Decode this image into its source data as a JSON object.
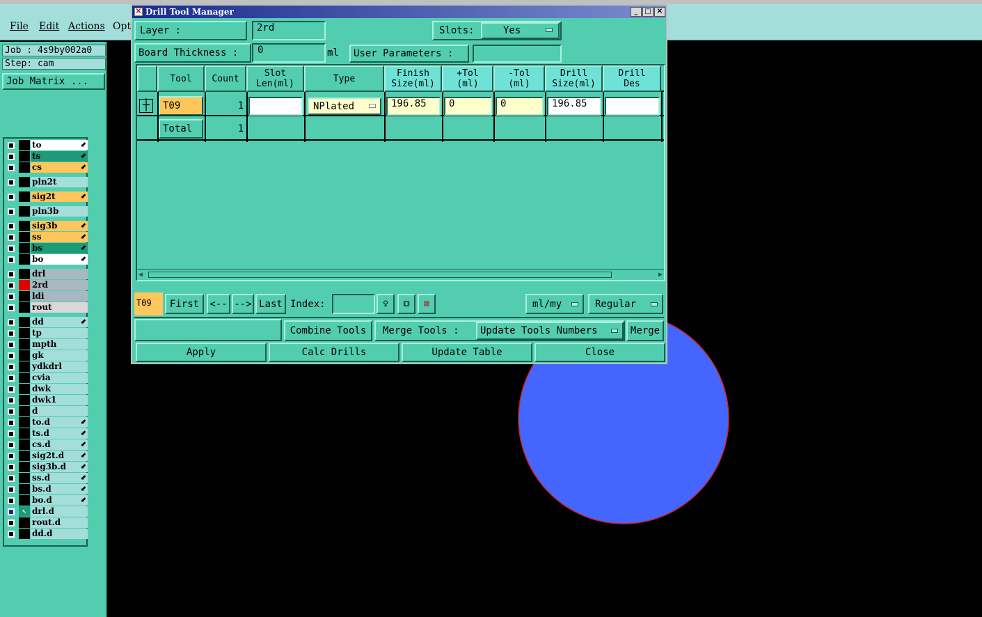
{
  "menubar": {
    "file": "File",
    "edit": "Edit",
    "actions": "Actions",
    "options": "Opti"
  },
  "left": {
    "job": "Job : 4s9by002a0",
    "step": "Step: cam",
    "job_matrix": "Job Matrix ...",
    "layers": [
      {
        "name": "to",
        "color": "#ffffff",
        "arrow": true
      },
      {
        "name": "ts",
        "color": "#1e9a78",
        "arrow": true
      },
      {
        "name": "cs",
        "color": "#ffc65c",
        "arrow": true
      },
      {
        "name": "pln2t",
        "color": "#a3dedb",
        "arrow": false
      },
      {
        "name": "sig2t",
        "color": "#ffc65c",
        "arrow": true
      },
      {
        "name": "pln3b",
        "color": "#a3dedb",
        "arrow": false
      },
      {
        "name": "sig3b",
        "color": "#ffc65c",
        "arrow": true
      },
      {
        "name": "ss",
        "color": "#ffc65c",
        "arrow": true
      },
      {
        "name": "bs",
        "color": "#1e9a78",
        "arrow": true
      },
      {
        "name": "bo",
        "color": "#ffffff",
        "arrow": true
      },
      {
        "name": "drl",
        "color": "#a8b8c0",
        "arrow": false
      },
      {
        "name": "2rd",
        "color": "#a8b8c0",
        "arrow": false
      },
      {
        "name": "ldi",
        "color": "#a8b8c0",
        "arrow": false
      },
      {
        "name": "rout",
        "color": "#d8d8d8",
        "arrow": false
      },
      {
        "name": "dd",
        "color": "#a3dedb",
        "arrow": true
      },
      {
        "name": "tp",
        "color": "#a3dedb",
        "arrow": false
      },
      {
        "name": "mpth",
        "color": "#a3dedb",
        "arrow": false
      },
      {
        "name": "gk",
        "color": "#a3dedb",
        "arrow": false
      },
      {
        "name": "ydkdrl",
        "color": "#a3dedb",
        "arrow": false
      },
      {
        "name": "cvia",
        "color": "#a3dedb",
        "arrow": false
      },
      {
        "name": "dwk",
        "color": "#a3dedb",
        "arrow": false
      },
      {
        "name": "dwk1",
        "color": "#a3dedb",
        "arrow": false
      },
      {
        "name": "d",
        "color": "#a3dedb",
        "arrow": false
      },
      {
        "name": "to.d",
        "color": "#a3dedb",
        "arrow": true
      },
      {
        "name": "ts.d",
        "color": "#a3dedb",
        "arrow": true
      },
      {
        "name": "cs.d",
        "color": "#a3dedb",
        "arrow": true
      },
      {
        "name": "sig2t.d",
        "color": "#a3dedb",
        "arrow": true
      },
      {
        "name": "sig3b.d",
        "color": "#a3dedb",
        "arrow": true
      },
      {
        "name": "ss.d",
        "color": "#a3dedb",
        "arrow": true
      },
      {
        "name": "bs.d",
        "color": "#a3dedb",
        "arrow": true
      },
      {
        "name": "bo.d",
        "color": "#a3dedb",
        "arrow": true
      },
      {
        "name": "drl.d",
        "color": "#a3dedb",
        "arrow": false
      },
      {
        "name": "rout.d",
        "color": "#a3dedb",
        "arrow": false
      },
      {
        "name": "dd.d",
        "color": "#a3dedb",
        "arrow": false
      }
    ]
  },
  "dialog": {
    "title": "Drill Tool Manager",
    "layer_label": "Layer          :",
    "layer_value": "2rd",
    "slots_label": "Slots:",
    "slots_value": "Yes",
    "thickness_label": "Board Thickness :",
    "thickness_value": "0",
    "thickness_unit": "ml",
    "user_params": "User Parameters :",
    "user_params_value": "",
    "headers": {
      "tool": "Tool",
      "count": "Count",
      "slot1": "Slot",
      "slot2": "Len(ml)",
      "type": "Type",
      "finish1": "Finish",
      "finish2": "Size(ml)",
      "ptol1": "+Tol",
      "ptol2": "(ml)",
      "mtol1": "-Tol",
      "mtol2": "(ml)",
      "drill1": "Drill",
      "drill2": "Size(ml)",
      "des1": "Drill",
      "des2": "Des"
    },
    "row": {
      "tool": "T09",
      "count": "1",
      "slot_len": "",
      "type": "NPlated",
      "finish": "196.85",
      "ptol": "0",
      "mtol": "0",
      "drill_size": "196.85",
      "des": ""
    },
    "total": {
      "label": "Total",
      "count": "1"
    },
    "nav": {
      "current": "T09",
      "first": "First",
      "prev": "<--",
      "next": "-->",
      "last": "Last",
      "index_label": "Index:",
      "index_value": "",
      "units": "ml/my",
      "mode": "Regular"
    },
    "actions": {
      "combine": "Combine Tools",
      "merge_label": "Merge Tools  :",
      "merge_option": "Update Tools Numbers",
      "merge": "Merge"
    },
    "bottom": {
      "apply": "Apply",
      "calc": "Calc Drills",
      "update": "Update Table",
      "close": "Close"
    }
  },
  "canvas": {
    "pad_color": "#4466ff",
    "pad_outline": "#d02020"
  }
}
